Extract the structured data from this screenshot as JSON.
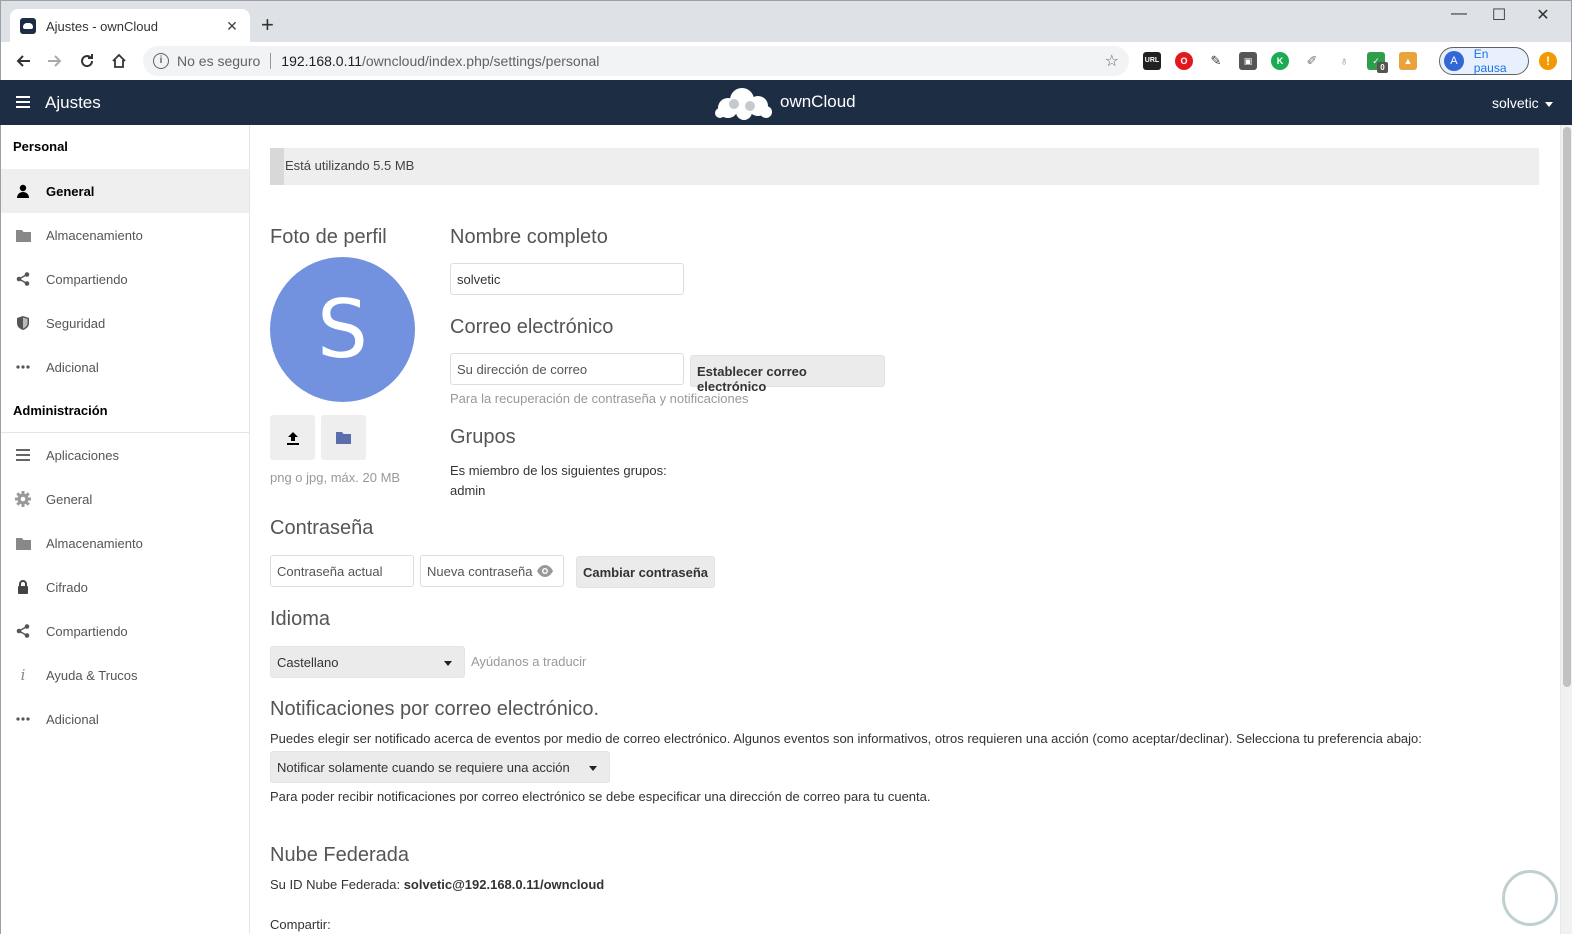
{
  "browser": {
    "tab_title": "Ajustes - ownCloud",
    "tab_close": "✕",
    "new_tab": "+",
    "security_label": "No es seguro",
    "url_host": "192.168.0.11",
    "url_path": "/owncloud/index.php/settings/personal",
    "profile_initial": "A",
    "profile_status": "En pausa",
    "extension_badge": "0",
    "extensions": [
      "url-extension-icon",
      "opera-icon",
      "pen-icon",
      "stack-icon",
      "k-icon",
      "pencil-icon",
      "bulb-icon",
      "check-icon",
      "bag-icon"
    ],
    "window_controls": {
      "minimize": "—",
      "maximize": "☐",
      "close": "✕"
    }
  },
  "header": {
    "menu_label": "Ajustes",
    "brand": "ownCloud",
    "user": "solvetic",
    "bg_color": "#1d2d44"
  },
  "sidebar": {
    "personal_heading": "Personal",
    "personal_items": [
      {
        "label": "General",
        "icon": "user-icon",
        "active": true
      },
      {
        "label": "Almacenamiento",
        "icon": "folder-icon"
      },
      {
        "label": "Compartiendo",
        "icon": "share-icon"
      },
      {
        "label": "Seguridad",
        "icon": "shield-icon"
      },
      {
        "label": "Adicional",
        "icon": "more-icon"
      }
    ],
    "admin_heading": "Administración",
    "admin_items": [
      {
        "label": "Aplicaciones",
        "icon": "list-icon"
      },
      {
        "label": "General",
        "icon": "gear-icon"
      },
      {
        "label": "Almacenamiento",
        "icon": "folder-icon"
      },
      {
        "label": "Cifrado",
        "icon": "lock-icon"
      },
      {
        "label": "Compartiendo",
        "icon": "share-icon"
      },
      {
        "label": "Ayuda & Trucos",
        "icon": "info-icon"
      },
      {
        "label": "Adicional",
        "icon": "more-icon"
      }
    ]
  },
  "main": {
    "quota_text": "Está utilizando 5.5 MB",
    "profile_photo": {
      "title": "Foto de perfil",
      "avatar_letter": "S",
      "avatar_color": "#7292e0",
      "hint": "png o jpg, máx. 20 MB"
    },
    "full_name": {
      "title": "Nombre completo",
      "value": "solvetic"
    },
    "email": {
      "title": "Correo electrónico",
      "placeholder": "Su dirección de correo",
      "button": "Establecer correo electrónico",
      "hint": "Para la recuperación de contraseña y notificaciones"
    },
    "groups": {
      "title": "Grupos",
      "member_text": "Es miembro de los siguientes grupos:",
      "groups": "admin"
    },
    "password": {
      "title": "Contraseña",
      "current_placeholder": "Contraseña actual",
      "new_placeholder": "Nueva contraseña",
      "button": "Cambiar contraseña"
    },
    "language": {
      "title": "Idioma",
      "selected": "Castellano",
      "help_link": "Ayúdanos a traducir"
    },
    "email_notifications": {
      "title": "Notificaciones por correo electrónico.",
      "description": "Puedes elegir ser notificado acerca de eventos por medio de correo electrónico. Algunos eventos son informativos, otros requieren una acción (como aceptar/declinar). Selecciona tu preferencia abajo:",
      "selected": "Notificar solamente cuando se requiere una acción",
      "note": "Para poder recibir notificaciones por correo electrónico se debe especificar una dirección de correo para tu cuenta."
    },
    "federated": {
      "title": "Nube Federada",
      "id_label": "Su ID Nube Federada:",
      "id_value": "solvetic@192.168.0.11/owncloud",
      "share_label": "Compartir:"
    }
  }
}
